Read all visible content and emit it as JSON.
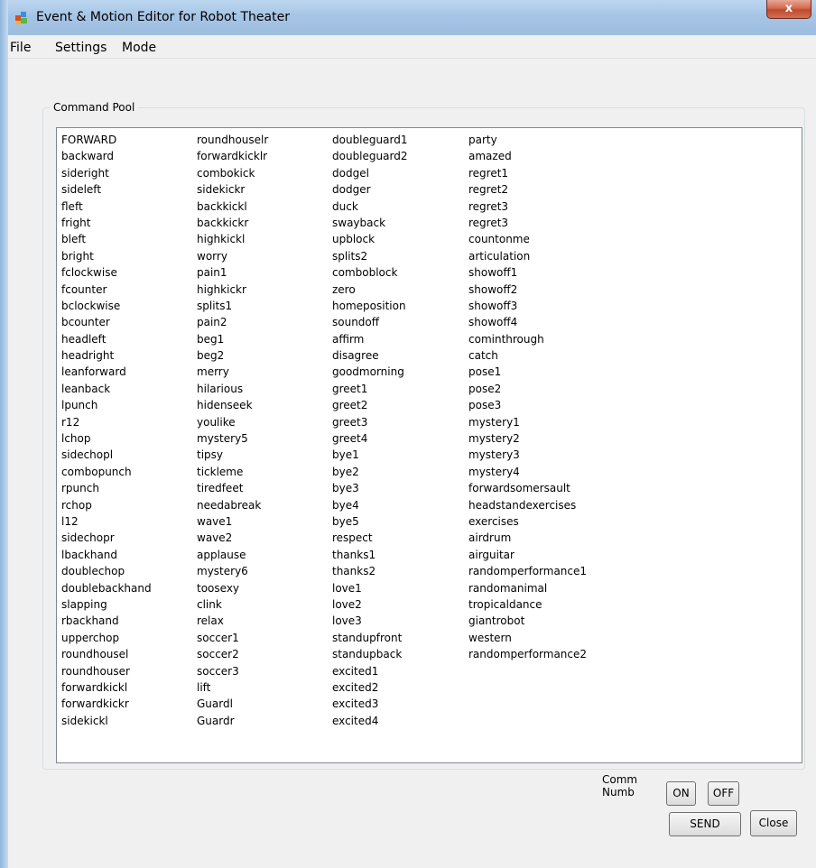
{
  "window": {
    "title": "Event & Motion Editor for Robot Theater",
    "close_label": "x"
  },
  "menu": {
    "items": [
      "File",
      "Settings",
      "Mode"
    ]
  },
  "command_pool": {
    "label": "Command Pool",
    "columns": [
      [
        "FORWARD",
        "backward",
        "sideright",
        "sideleft",
        "fleft",
        "fright",
        "bleft",
        "bright",
        "fclockwise",
        "fcounter",
        "bclockwise",
        "bcounter",
        "headleft",
        "headright",
        "leanforward",
        "leanback",
        "lpunch",
        "r12",
        "lchop",
        "sidechopl",
        "combopunch",
        "rpunch",
        "rchop",
        "l12",
        "sidechopr",
        "lbackhand",
        "doublechop",
        "doublebackhand",
        "slapping",
        "rbackhand",
        "upperchop",
        "roundhousel",
        "roundhouser",
        "forwardkickl",
        "forwardkickr",
        "sidekickl"
      ],
      [
        "roundhouselr",
        "forwardkicklr",
        "combokick",
        "sidekickr",
        "backkickl",
        "backkickr",
        "highkickl",
        "worry",
        "pain1",
        "highkickr",
        "splits1",
        "pain2",
        "beg1",
        "beg2",
        "merry",
        "hilarious",
        "hidenseek",
        "youlike",
        "mystery5",
        "tipsy",
        "tickleme",
        "tiredfeet",
        "needabreak",
        "wave1",
        "wave2",
        "applause",
        "mystery6",
        "toosexy",
        "clink",
        "relax",
        "soccer1",
        "soccer2",
        "soccer3",
        "lift",
        "Guardl",
        "Guardr"
      ],
      [
        "doubleguard1",
        "doubleguard2",
        "dodgel",
        "dodger",
        "duck",
        "swayback",
        "upblock",
        "splits2",
        "comboblock",
        "zero",
        "homeposition",
        "soundoff",
        "affirm",
        "disagree",
        "goodmorning",
        "greet1",
        "greet2",
        "greet3",
        "greet4",
        "bye1",
        "bye2",
        "bye3",
        "bye4",
        "bye5",
        "respect",
        "thanks1",
        "thanks2",
        "love1",
        "love2",
        "love3",
        "standupfront",
        "standupback",
        "excited1",
        "excited2",
        "excited3",
        "excited4"
      ],
      [
        "party",
        "amazed",
        "regret1",
        "regret2",
        "regret3",
        "regret3",
        "countonme",
        "articulation",
        "showoff1",
        "showoff2",
        "showoff3",
        "showoff4",
        "cominthrough",
        "catch",
        "pose1",
        "pose2",
        "pose3",
        "mystery1",
        "mystery2",
        "mystery3",
        "mystery4",
        "forwardsomersault",
        "headstandexercises",
        "exercises",
        "airdrum",
        "airguitar",
        "randomperformance1",
        "randomanimal",
        "tropicaldance",
        "giantrobot",
        "western",
        "randomperformance2"
      ]
    ]
  },
  "controls": {
    "comm_label": "Comm",
    "numb_label": "Numb",
    "on_label": "ON",
    "off_label": "OFF",
    "send_label": "SEND",
    "close_label": "Close"
  }
}
